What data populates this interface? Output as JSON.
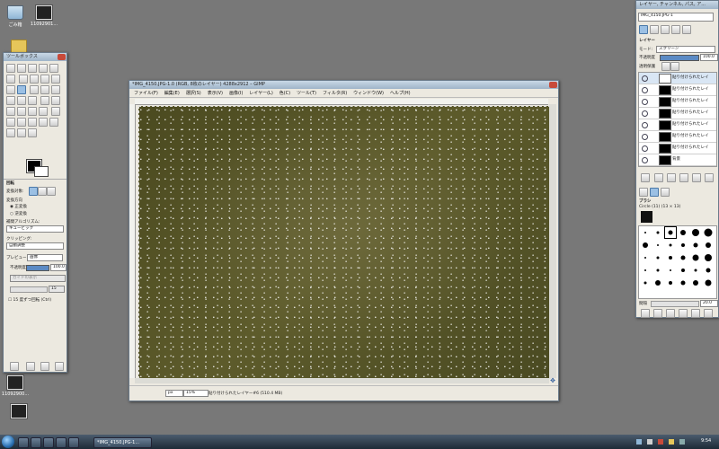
{
  "desktop": {
    "icons": [
      {
        "label": "ごみ箱"
      },
      {
        "label": "11092901..."
      },
      {
        "label": "11092900..."
      }
    ]
  },
  "toolbox": {
    "title": "ツールボックス",
    "options_title": "回転",
    "transform_label": "変換対象:",
    "direction_label": "変換方向",
    "direction_options": [
      "正変換",
      "逆変換"
    ],
    "interpolation_label": "補間アルゴリズム:",
    "interpolation_value": "キュービック",
    "clipping_label": "クリッピング:",
    "clipping_value": "自動調整",
    "preview_label": "プレビュー:",
    "preview_value": "画像",
    "opacity_label": "不透明度",
    "opacity_value": "100.0",
    "guides_value": "ガイドの表示",
    "guide_count": "15",
    "snap_label": "15 度ずつ回転 (Ctrl)"
  },
  "image_window": {
    "title": "*IMG_4150.JPG-1.0 (RGB, 8枚のレイヤー) 4288x2912 – GIMP",
    "menus": [
      "ファイル(F)",
      "編集(E)",
      "選択(S)",
      "表示(V)",
      "画像(I)",
      "レイヤー(L)",
      "色(C)",
      "ツール(T)",
      "フィルタ(R)",
      "ウィンドウ(W)",
      "ヘルプ(H)"
    ],
    "unit": "px",
    "zoom": "15%",
    "status": "貼り付けられたレイヤー#6 (510.4 MB)"
  },
  "layers_panel": {
    "title": "レイヤー, チャンネル, パス, ア...",
    "image_selector": "IMG_4150.JPG-1",
    "tab_label": "レイヤー",
    "mode_label": "モード:",
    "mode_value": "スクリーン",
    "opacity_label": "不透明度",
    "opacity_value": "100.0",
    "lock_label": "透明保護",
    "layers": [
      {
        "name": "貼り付けられたレイ"
      },
      {
        "name": "貼り付けられたレイ"
      },
      {
        "name": "貼り付けられたレイ"
      },
      {
        "name": "貼り付けられたレイ"
      },
      {
        "name": "貼り付けられたレイ"
      },
      {
        "name": "貼り付けられたレイ"
      },
      {
        "name": "貼り付けられたレイ"
      },
      {
        "name": "背景"
      }
    ],
    "brush_tab": "ブラシ",
    "brush_name": "Circle (11) (13 × 13)",
    "spacing_label": "間隔",
    "spacing_value": "20.0"
  },
  "taskbar": {
    "task_label": "*IMG_4150.JPG-1...",
    "clock": "9:54"
  }
}
